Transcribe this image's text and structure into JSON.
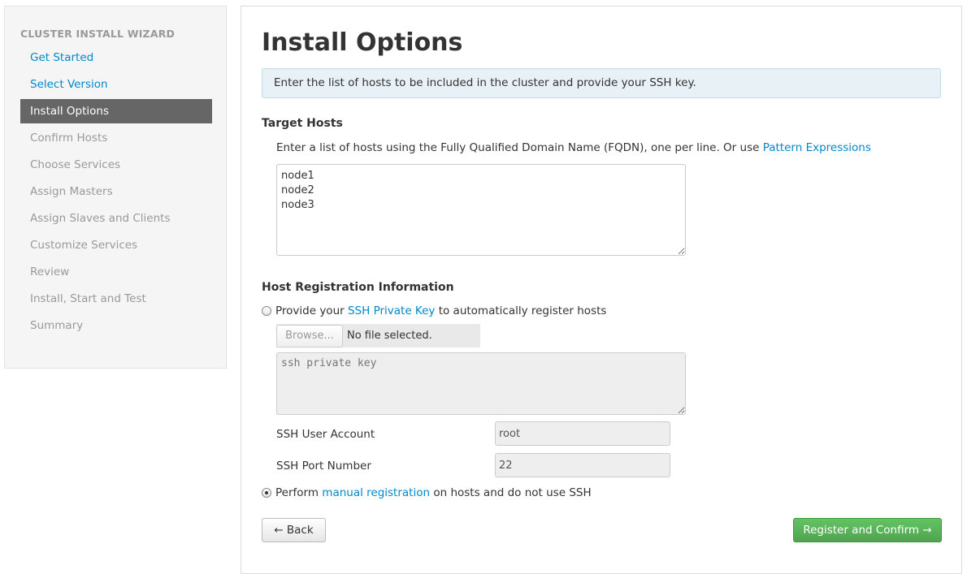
{
  "sidebar": {
    "header": "CLUSTER INSTALL WIZARD",
    "steps": [
      {
        "label": "Get Started",
        "state": "done"
      },
      {
        "label": "Select Version",
        "state": "done"
      },
      {
        "label": "Install Options",
        "state": "active"
      },
      {
        "label": "Confirm Hosts",
        "state": "todo"
      },
      {
        "label": "Choose Services",
        "state": "todo"
      },
      {
        "label": "Assign Masters",
        "state": "todo"
      },
      {
        "label": "Assign Slaves and Clients",
        "state": "todo"
      },
      {
        "label": "Customize Services",
        "state": "todo"
      },
      {
        "label": "Review",
        "state": "todo"
      },
      {
        "label": "Install, Start and Test",
        "state": "todo"
      },
      {
        "label": "Summary",
        "state": "todo"
      }
    ]
  },
  "main": {
    "title": "Install Options",
    "alert": "Enter the list of hosts to be included in the cluster and provide your SSH key.",
    "target_hosts": {
      "title": "Target Hosts",
      "hint_text": "Enter a list of hosts using the Fully Qualified Domain Name (FQDN), one per line. Or use ",
      "hint_link": "Pattern Expressions",
      "hosts_value": "node1\nnode2\nnode3"
    },
    "registration": {
      "title": "Host Registration Information",
      "ssh_option": {
        "prefix": "Provide your ",
        "link": "SSH Private Key",
        "suffix": " to automatically register hosts",
        "checked": false
      },
      "browse_label": "Browse...",
      "file_status": "No file selected.",
      "key_placeholder": "ssh private key",
      "user_label": "SSH User Account",
      "user_value": "root",
      "port_label": "SSH Port Number",
      "port_value": "22",
      "manual_option": {
        "prefix": "Perform ",
        "link": "manual registration",
        "suffix": " on hosts and do not use SSH",
        "checked": true
      }
    },
    "buttons": {
      "back": "← Back",
      "next": "Register and Confirm →"
    }
  },
  "colors": {
    "link": "#0088cc",
    "active_step_bg": "#666666",
    "primary_button": "#51a351",
    "alert_bg": "#e8f1f6"
  }
}
